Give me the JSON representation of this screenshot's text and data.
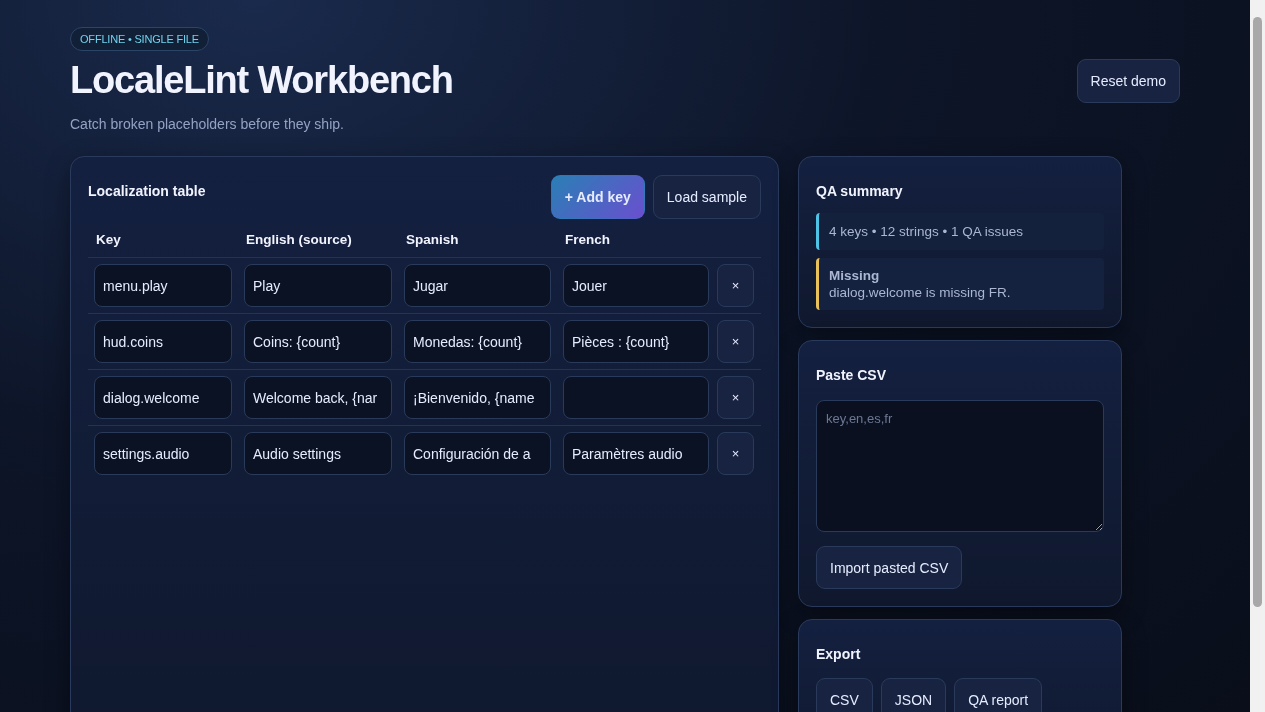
{
  "badge": "OFFLINE • SINGLE FILE",
  "title": "LocaleLint Workbench",
  "subtitle": "Catch broken placeholders before they ship.",
  "reset_button": "Reset demo",
  "table": {
    "title": "Localization table",
    "add_button": "+ Add key",
    "load_button": "Load sample",
    "columns": [
      "Key",
      "English (source)",
      "Spanish",
      "French"
    ],
    "rows": [
      {
        "key": "menu.play",
        "en": "Play",
        "es": "Jugar",
        "fr": "Jouer",
        "delete": "×"
      },
      {
        "key": "hud.coins",
        "en": "Coins: {count}",
        "es": "Monedas: {count}",
        "fr": "Pièces : {count}",
        "delete": "×"
      },
      {
        "key": "dialog.welcome",
        "en": "Welcome back, {nar",
        "es": "¡Bienvenido, {name",
        "delete": "×"
      },
      {
        "key": "settings.audio",
        "en": "Audio settings",
        "es": "Configuración de a",
        "fr": "Paramètres audio",
        "delete": "×"
      }
    ]
  },
  "qa_summary": {
    "title": "QA summary",
    "stats": "4 keys • 12 strings • 1 QA issues",
    "issues": [
      {
        "title": "Missing",
        "text": "dialog.welcome is missing FR.",
        "color": "#e8c15a"
      }
    ]
  },
  "paste_csv": {
    "title": "Paste CSV",
    "placeholder": "key,en,es,fr",
    "import_button": "Import pasted CSV"
  },
  "export": {
    "title": "Export",
    "buttons": [
      "CSV",
      "JSON",
      "QA report"
    ]
  }
}
